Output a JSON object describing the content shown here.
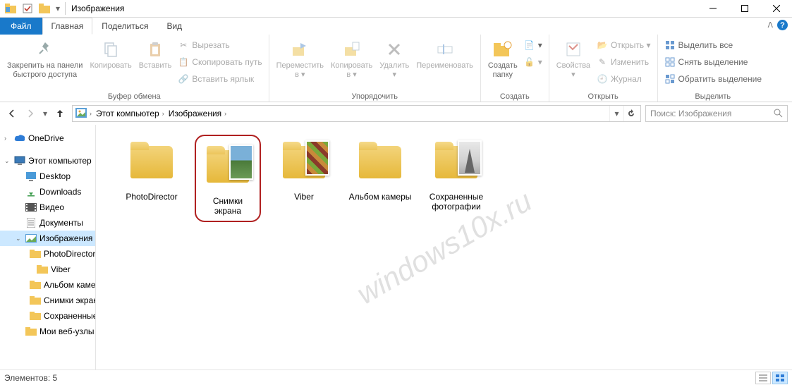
{
  "window": {
    "title": "Изображения"
  },
  "tabs": {
    "file": "Файл",
    "home": "Главная",
    "share": "Поделиться",
    "view": "Вид"
  },
  "ribbon": {
    "clipboard": {
      "pin": "Закрепить на панели\nбыстрого доступа",
      "copy": "Копировать",
      "paste": "Вставить",
      "cut": "Вырезать",
      "copypath": "Скопировать путь",
      "pasteshortcut": "Вставить ярлык",
      "label": "Буфер обмена"
    },
    "organize": {
      "moveto": "Переместить\nв ▾",
      "copyto": "Копировать\nв ▾",
      "delete": "Удалить\n▾",
      "rename": "Переименовать",
      "label": "Упорядочить"
    },
    "new": {
      "newfolder": "Создать\nпапку",
      "label": "Создать"
    },
    "open": {
      "properties": "Свойства\n▾",
      "open": "Открыть ▾",
      "edit": "Изменить",
      "history": "Журнал",
      "label": "Открыть"
    },
    "select": {
      "selectall": "Выделить все",
      "selectnone": "Снять выделение",
      "invert": "Обратить выделение",
      "label": "Выделить"
    }
  },
  "breadcrumbs": {
    "b1": "Этот компьютер",
    "b2": "Изображения"
  },
  "search": {
    "placeholder": "Поиск: Изображения"
  },
  "tree": {
    "onedrive": "OneDrive",
    "thispc": "Этот компьютер",
    "desktop": "Desktop",
    "downloads": "Downloads",
    "videos": "Видео",
    "documents": "Документы",
    "pictures": "Изображения",
    "photodirector": "PhotoDirector",
    "viber": "Viber",
    "albumcam": "Альбом камеры",
    "screenshots": "Снимки экрана",
    "saved": "Сохраненные",
    "mywebsites": "Мои веб-узлы"
  },
  "folders": {
    "f1": "PhotoDirector",
    "f2": "Снимки экрана",
    "f3": "Viber",
    "f4": "Альбом камеры",
    "f5": "Сохраненные\nфотографии"
  },
  "statusbar": {
    "count": "Элементов: 5"
  },
  "watermark": "windows10x.ru"
}
